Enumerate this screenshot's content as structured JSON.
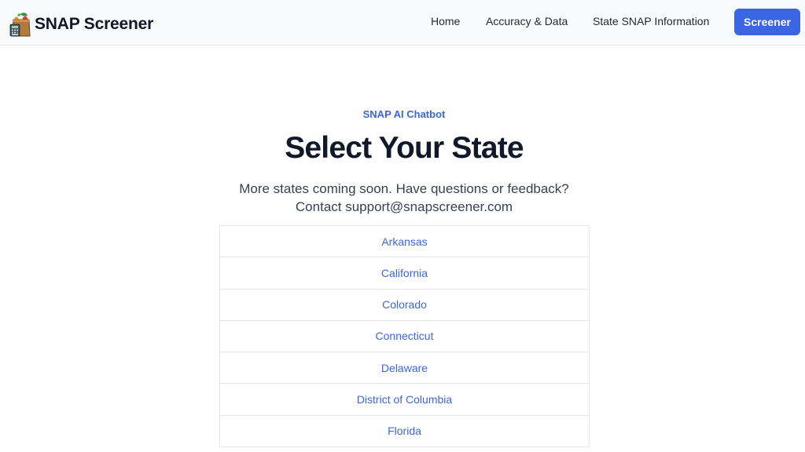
{
  "nav": {
    "brand_name": "SNAP Screener",
    "links": [
      {
        "label": "Home"
      },
      {
        "label": "Accuracy & Data"
      },
      {
        "label": "State SNAP Information"
      }
    ],
    "cta_label": "Screener"
  },
  "hero": {
    "eyebrow": "SNAP AI Chatbot",
    "title": "Select Your State",
    "subtitle_line1": "More states coming soon. Have questions or feedback?",
    "subtitle_line2": "Contact support@snapscreener.com"
  },
  "states": [
    {
      "label": "Arkansas"
    },
    {
      "label": "California"
    },
    {
      "label": "Colorado"
    },
    {
      "label": "Connecticut"
    },
    {
      "label": "Delaware"
    },
    {
      "label": "District of Columbia"
    },
    {
      "label": "Florida"
    }
  ],
  "colors": {
    "accent": "#3b66e3",
    "nav_bg": "#f9fafb",
    "text_dark": "#111827",
    "border": "#e5e7eb"
  },
  "icons": {
    "brand_logo": "grocery-bag-calculator-icon"
  }
}
